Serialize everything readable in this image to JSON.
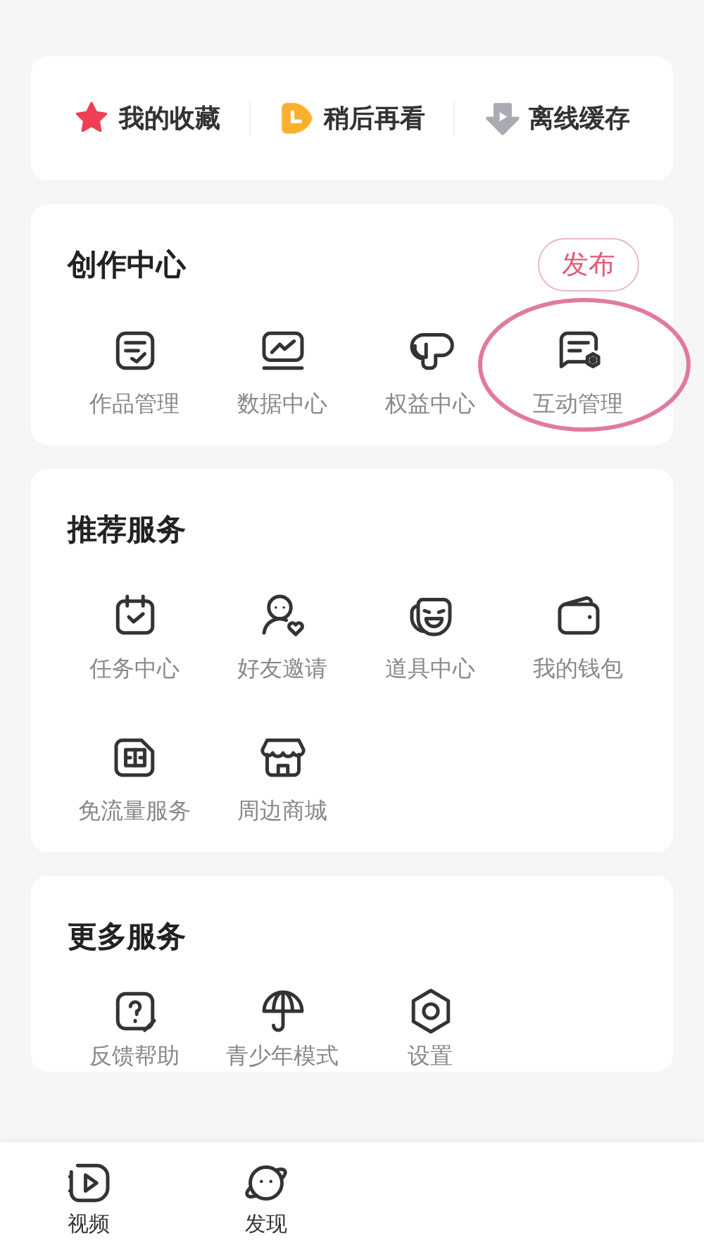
{
  "quick_links": [
    {
      "label": "我的收藏",
      "kind": "star"
    },
    {
      "label": "稍后再看",
      "kind": "clock"
    },
    {
      "label": "离线缓存",
      "kind": "download"
    }
  ],
  "creator_center": {
    "title": "创作中心",
    "publish_button": "发布",
    "items": [
      {
        "label": "作品管理",
        "kind": "doc-check",
        "highlighted": false
      },
      {
        "label": "数据中心",
        "kind": "chart",
        "highlighted": false
      },
      {
        "label": "权益中心",
        "kind": "bubbles",
        "highlighted": false
      },
      {
        "label": "互动管理",
        "kind": "chat-gear",
        "highlighted": true
      }
    ]
  },
  "recommended_services": {
    "title": "推荐服务",
    "items": [
      {
        "label": "任务中心",
        "kind": "calendar"
      },
      {
        "label": "好友邀请",
        "kind": "person-heart"
      },
      {
        "label": "道具中心",
        "kind": "mask"
      },
      {
        "label": "我的钱包",
        "kind": "wallet"
      },
      {
        "label": "免流量服务",
        "kind": "sim"
      },
      {
        "label": "周边商城",
        "kind": "shop"
      }
    ]
  },
  "more_services": {
    "title": "更多服务",
    "items": [
      {
        "label": "反馈帮助",
        "kind": "question"
      },
      {
        "label": "青少年模式",
        "kind": "umbrella"
      },
      {
        "label": "设置",
        "kind": "hexagon"
      }
    ]
  },
  "bottom_nav": [
    {
      "label": "视频",
      "kind": "video"
    },
    {
      "label": "发现",
      "kind": "planet"
    }
  ]
}
